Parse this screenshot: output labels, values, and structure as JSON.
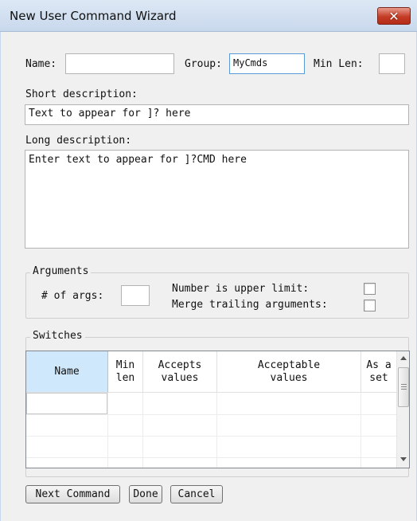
{
  "window": {
    "title": "New User Command Wizard"
  },
  "form": {
    "name_label": "Name:",
    "name_value": "",
    "group_label": "Group:",
    "group_value": "MyCmds",
    "minlen_label": "Min Len:",
    "minlen_value": "",
    "short_desc_label": "Short description:",
    "short_desc_value": "Text to appear for ]? here",
    "long_desc_label": "Long description:",
    "long_desc_value": "Enter text to appear for ]?CMD here"
  },
  "arguments": {
    "group_title": "Arguments",
    "num_args_label": "# of args:",
    "num_args_value": "",
    "upper_limit_label": "Number is upper limit:",
    "upper_limit_checked": false,
    "merge_label": "Merge trailing arguments:",
    "merge_checked": false
  },
  "switches": {
    "group_title": "Switches",
    "columns": [
      "Name",
      "Min\nlen",
      "Accepts\nvalues",
      "Acceptable\nvalues",
      "As a\nset"
    ],
    "rows": [
      [
        "",
        "",
        "",
        "",
        ""
      ],
      [
        "",
        "",
        "",
        "",
        ""
      ],
      [
        "",
        "",
        "",
        "",
        ""
      ],
      [
        "",
        "",
        "",
        "",
        ""
      ]
    ]
  },
  "buttons": {
    "next": "Next Command",
    "done": "Done",
    "cancel": "Cancel"
  },
  "colors": {
    "selected_header": "#cfe8fb",
    "close_button": "#c43c26",
    "focus_border": "#5b9bd5"
  }
}
